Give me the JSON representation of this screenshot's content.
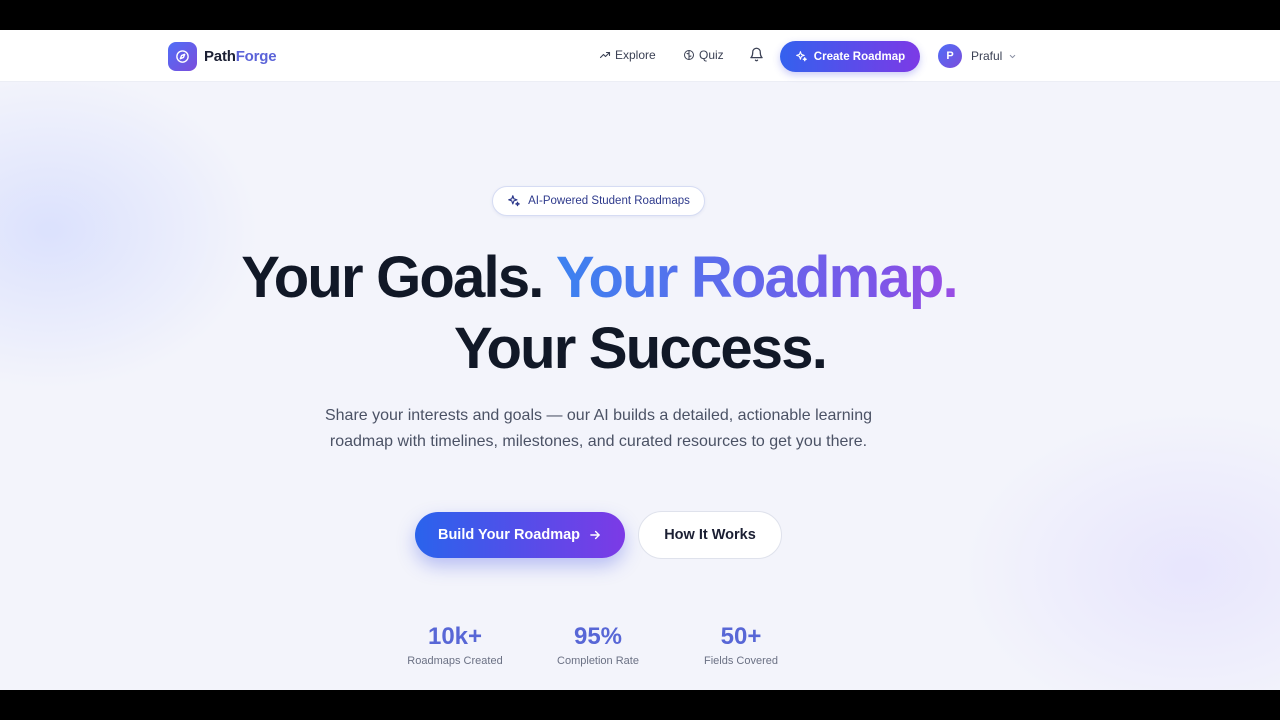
{
  "brand": {
    "name_part1": "Path",
    "name_part2": "Forge"
  },
  "nav": {
    "explore_label": "Explore",
    "quiz_label": "Quiz",
    "create_label": "Create Roadmap",
    "user_initial": "P",
    "user_name": "Praful"
  },
  "hero": {
    "badge": "AI-Powered Student Roadmaps",
    "headline_part1": "Your Goals.",
    "headline_part2": "Your Roadmap.",
    "headline_part3": "Your Success.",
    "subtitle": "Share your interests and goals — our AI builds a detailed, actionable learning roadmap with timelines, milestones, and curated resources to get you there.",
    "cta_primary": "Build Your Roadmap",
    "cta_secondary": "How It Works"
  },
  "stats": [
    {
      "value": "10k+",
      "label": "Roadmaps Created"
    },
    {
      "value": "95%",
      "label": "Completion Rate"
    },
    {
      "value": "50+",
      "label": "Fields Covered"
    }
  ],
  "icons": {
    "logo": "compass-icon",
    "explore": "trending-up-icon",
    "quiz": "brain-icon",
    "notifications": "bell-icon",
    "sparkles": "sparkles-icon",
    "arrow": "arrow-right-icon",
    "dropdown": "chevron-down-icon"
  },
  "colors": {
    "accent_start": "#3461ee",
    "accent_end": "#7c3ae6",
    "stat_value": "#5867d6",
    "heading": "#111827"
  }
}
